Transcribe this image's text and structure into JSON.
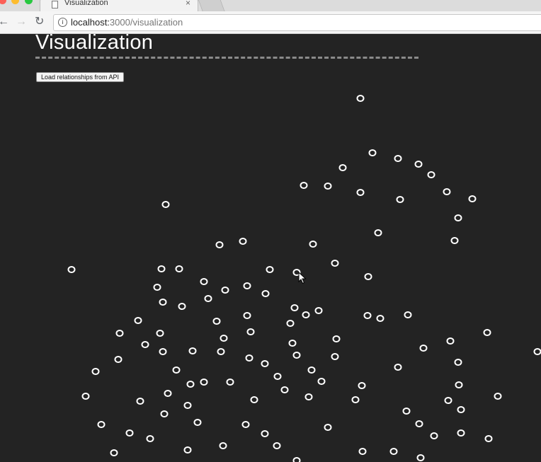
{
  "browser": {
    "tab_title": "Visualization",
    "tab_close": "×",
    "url_host": "localhost:",
    "url_path": "3000/visualization",
    "icons": {
      "back": "arrow-left-icon",
      "forward": "arrow-right-icon",
      "reload": "reload-icon",
      "info": "info-icon",
      "page": "document-icon"
    }
  },
  "page": {
    "title": "Visualization",
    "load_button_label": "Load relationships from API"
  },
  "colors": {
    "background": "#232323",
    "node_stroke": "#ffffff",
    "rule": "#8a8a8a"
  },
  "visualization": {
    "node_count": 107
  }
}
